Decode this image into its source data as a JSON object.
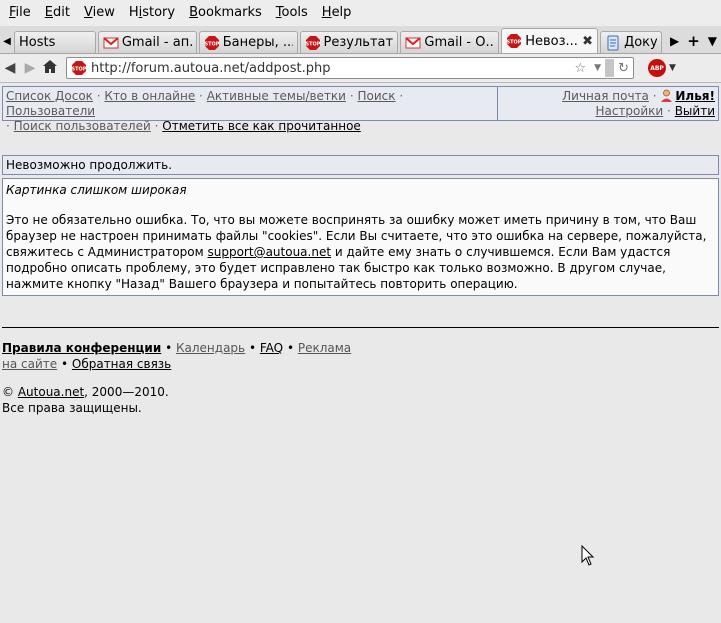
{
  "menu": [
    "File",
    "Edit",
    "View",
    "History",
    "Bookmarks",
    "Tools",
    "Help"
  ],
  "tabs": [
    {
      "label": "Hosts",
      "icon": "none"
    },
    {
      "label": "Gmail - ап...",
      "icon": "gmail-icon"
    },
    {
      "label": "Банеры, ...",
      "icon": "stop-icon"
    },
    {
      "label": "Результат...",
      "icon": "stop-icon"
    },
    {
      "label": "Gmail - О...",
      "icon": "gmail-icon"
    },
    {
      "label": "Невоз...",
      "icon": "stop-icon",
      "active": true
    },
    {
      "label": "Докум",
      "icon": "document-icon"
    }
  ],
  "url": "http://forum.autoua.net/addpost.php",
  "abp_label": "ABP",
  "forum_nav": {
    "left": [
      "Список Досок",
      "Кто в онлайне",
      "Активные темы/ветки",
      "Поиск",
      "Пользователи",
      "Поиск пользователей",
      "Отметить все как прочитанное"
    ],
    "right": {
      "mail": "Личная почта",
      "user": "Илья!",
      "settings": "Настройки",
      "logout": "Выйти"
    }
  },
  "message": {
    "title": "Невозможно продолжить.",
    "error": "Картинка слишком широкая",
    "text_before_link": "Это не обязательно ошибка. То, что вы можете воспринять за ошибку может иметь причину в том, что Ваш браузер не настроен принимать файлы \"cookies\". Если Вы считаете, что это ошибка на сервере, пожалуйста, свяжитесь с Администратором ",
    "email": "support@autoua.net",
    "text_after_link": " и дайте ему знать о случившемся. Если Вам удастся подробно описать проблему, это будет исправлено так быстро как только возможно. В другом случае, нажмите кнопку \"Назад\" Вашего браузера и попытайтесь повторить операцию."
  },
  "footer": {
    "rules": "Правила конференции",
    "calendar": "Календарь",
    "faq": "FAQ",
    "ads": "Реклама",
    "on_site": "на сайте",
    "feedback": "Обратная связь",
    "copyright_symbol": "©",
    "copyright_site": "Autoua.net",
    "copyright_years": ", 2000—2010.",
    "rights": "Все права защищены."
  }
}
